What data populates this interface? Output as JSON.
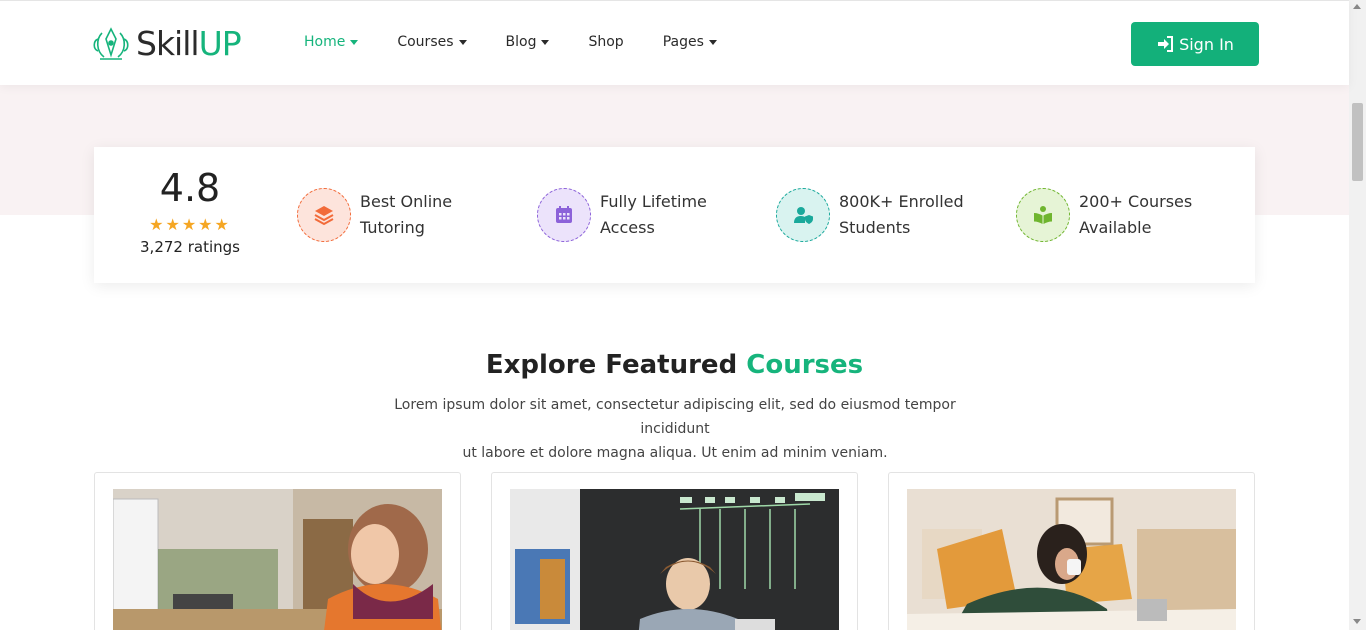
{
  "header": {
    "logo_part1": "Skill",
    "logo_part2": "UP",
    "nav": [
      {
        "label": "Home",
        "active": true,
        "dropdown": true
      },
      {
        "label": "Courses",
        "active": false,
        "dropdown": true
      },
      {
        "label": "Blog",
        "active": false,
        "dropdown": true
      },
      {
        "label": "Shop",
        "active": false,
        "dropdown": false
      },
      {
        "label": "Pages",
        "active": false,
        "dropdown": true
      }
    ],
    "signin_label": "Sign In"
  },
  "stats": {
    "rating": "4.8",
    "stars": "★★★★★",
    "ratings_count": "3,272 ratings",
    "features": [
      {
        "line1": "Best Online",
        "line2": "Tutoring",
        "icon": "layers-icon",
        "color": "#f26b3a"
      },
      {
        "line1": "Fully Lifetime",
        "line2": "Access",
        "icon": "calendar-icon",
        "color": "#8c62d9"
      },
      {
        "line1": "800K+ Enrolled",
        "line2": "Students",
        "icon": "user-shield-icon",
        "color": "#1aa99b"
      },
      {
        "line1": "200+ Courses",
        "line2": "Available",
        "icon": "book-reader-icon",
        "color": "#6fb52f"
      }
    ]
  },
  "section": {
    "title_part1": "Explore Featured",
    "title_part2": "Courses",
    "desc_line1": "Lorem ipsum dolor sit amet, consectetur adipiscing elit, sed do eiusmod tempor incididunt",
    "desc_line2": "ut labore et dolore magna aliqua. Ut enim ad minim veniam."
  },
  "colors": {
    "brand": "#16b47c",
    "band": "#f9f2f3"
  }
}
